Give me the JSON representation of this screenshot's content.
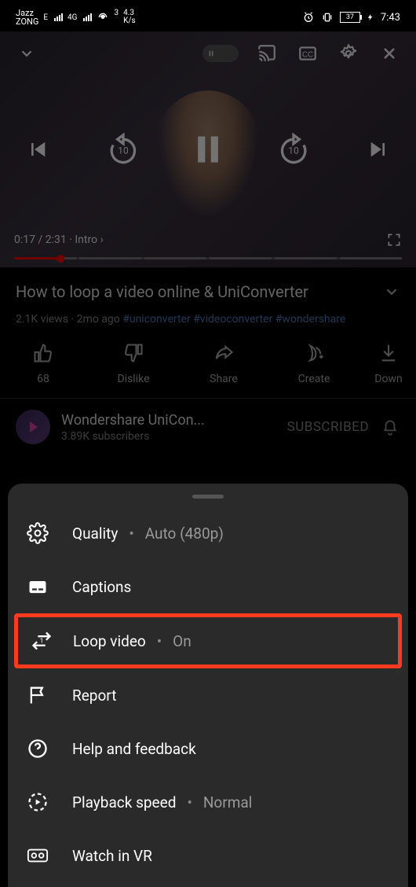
{
  "status": {
    "carrier1": "Jazz",
    "carrier2": "ZONG",
    "net_e": "E",
    "net_4g": "4G",
    "hotspot_count": "3",
    "speed": "4.3",
    "speed_unit": "K/s",
    "battery": "37",
    "time": "7:43"
  },
  "video": {
    "current_time": "0:17",
    "duration": "2:31",
    "chapter": "Intro",
    "title": "How to loop a video online & UniConverter",
    "views": "2.1K views",
    "age": "2mo ago",
    "hashtags": [
      "#uniconverter",
      "#videoconverter",
      "#wondershare"
    ]
  },
  "actions": {
    "like_count": "68",
    "dislike": "Dislike",
    "share": "Share",
    "create": "Create",
    "download": "Down"
  },
  "channel": {
    "name": "Wondershare UniCon...",
    "subs": "3.89K subscribers",
    "status": "SUBSCRIBED"
  },
  "sheet": {
    "quality_label": "Quality",
    "quality_value": "Auto (480p)",
    "captions": "Captions",
    "loop_label": "Loop video",
    "loop_value": "On",
    "report": "Report",
    "help": "Help and feedback",
    "speed_label": "Playback speed",
    "speed_value": "Normal",
    "vr": "Watch in VR"
  }
}
